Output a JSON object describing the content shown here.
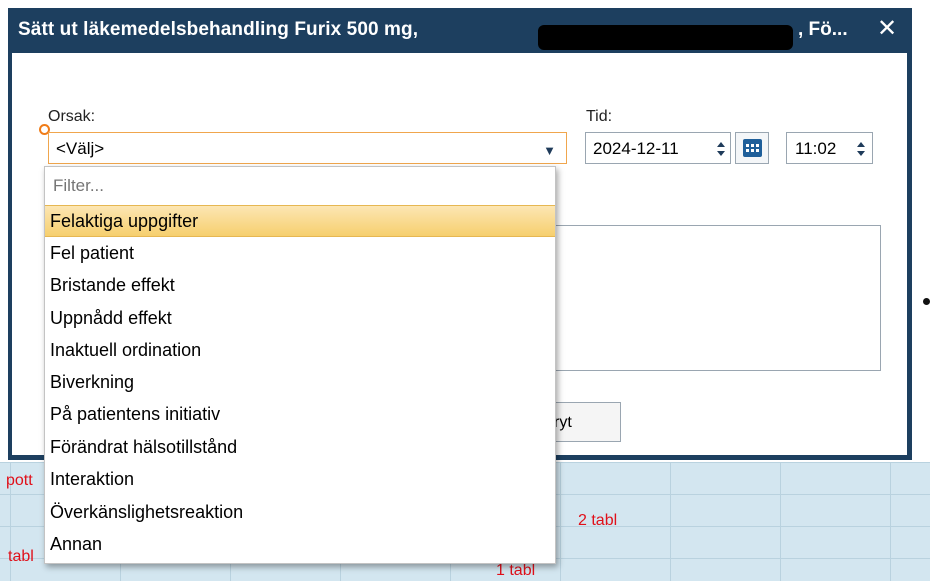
{
  "dialog": {
    "title": "Sätt ut läkemedelsbehandling Furix 500 mg,",
    "title_tail": ", Fö...",
    "close_icon": "close-icon"
  },
  "form": {
    "orsak_label": "Orsak:",
    "orsak_value": "<Välj>",
    "tid_label": "Tid:",
    "date_value": "2024-12-11",
    "time_value": "11:02",
    "cancel_label_visible": "ryt"
  },
  "dropdown": {
    "filter_placeholder": "Filter...",
    "options": [
      "Felaktiga uppgifter",
      "Fel patient",
      "Bristande effekt",
      "Uppnådd effekt",
      "Inaktuell ordination",
      "Biverkning",
      "På patientens initiativ",
      "Förändrat hälsotillstånd",
      "Interaktion",
      "Överkänslighetsreaktion",
      "Annan"
    ],
    "highlighted_index": 0
  },
  "background": {
    "frag1": "pott",
    "frag2": "tabl",
    "frag3": "2 tabl",
    "frag4": "1 tabl"
  },
  "colors": {
    "titlebar": "#1d3f5f",
    "highlight": "#f6cf6e",
    "required": "#f07c18",
    "bg_text": "#e0101a"
  }
}
